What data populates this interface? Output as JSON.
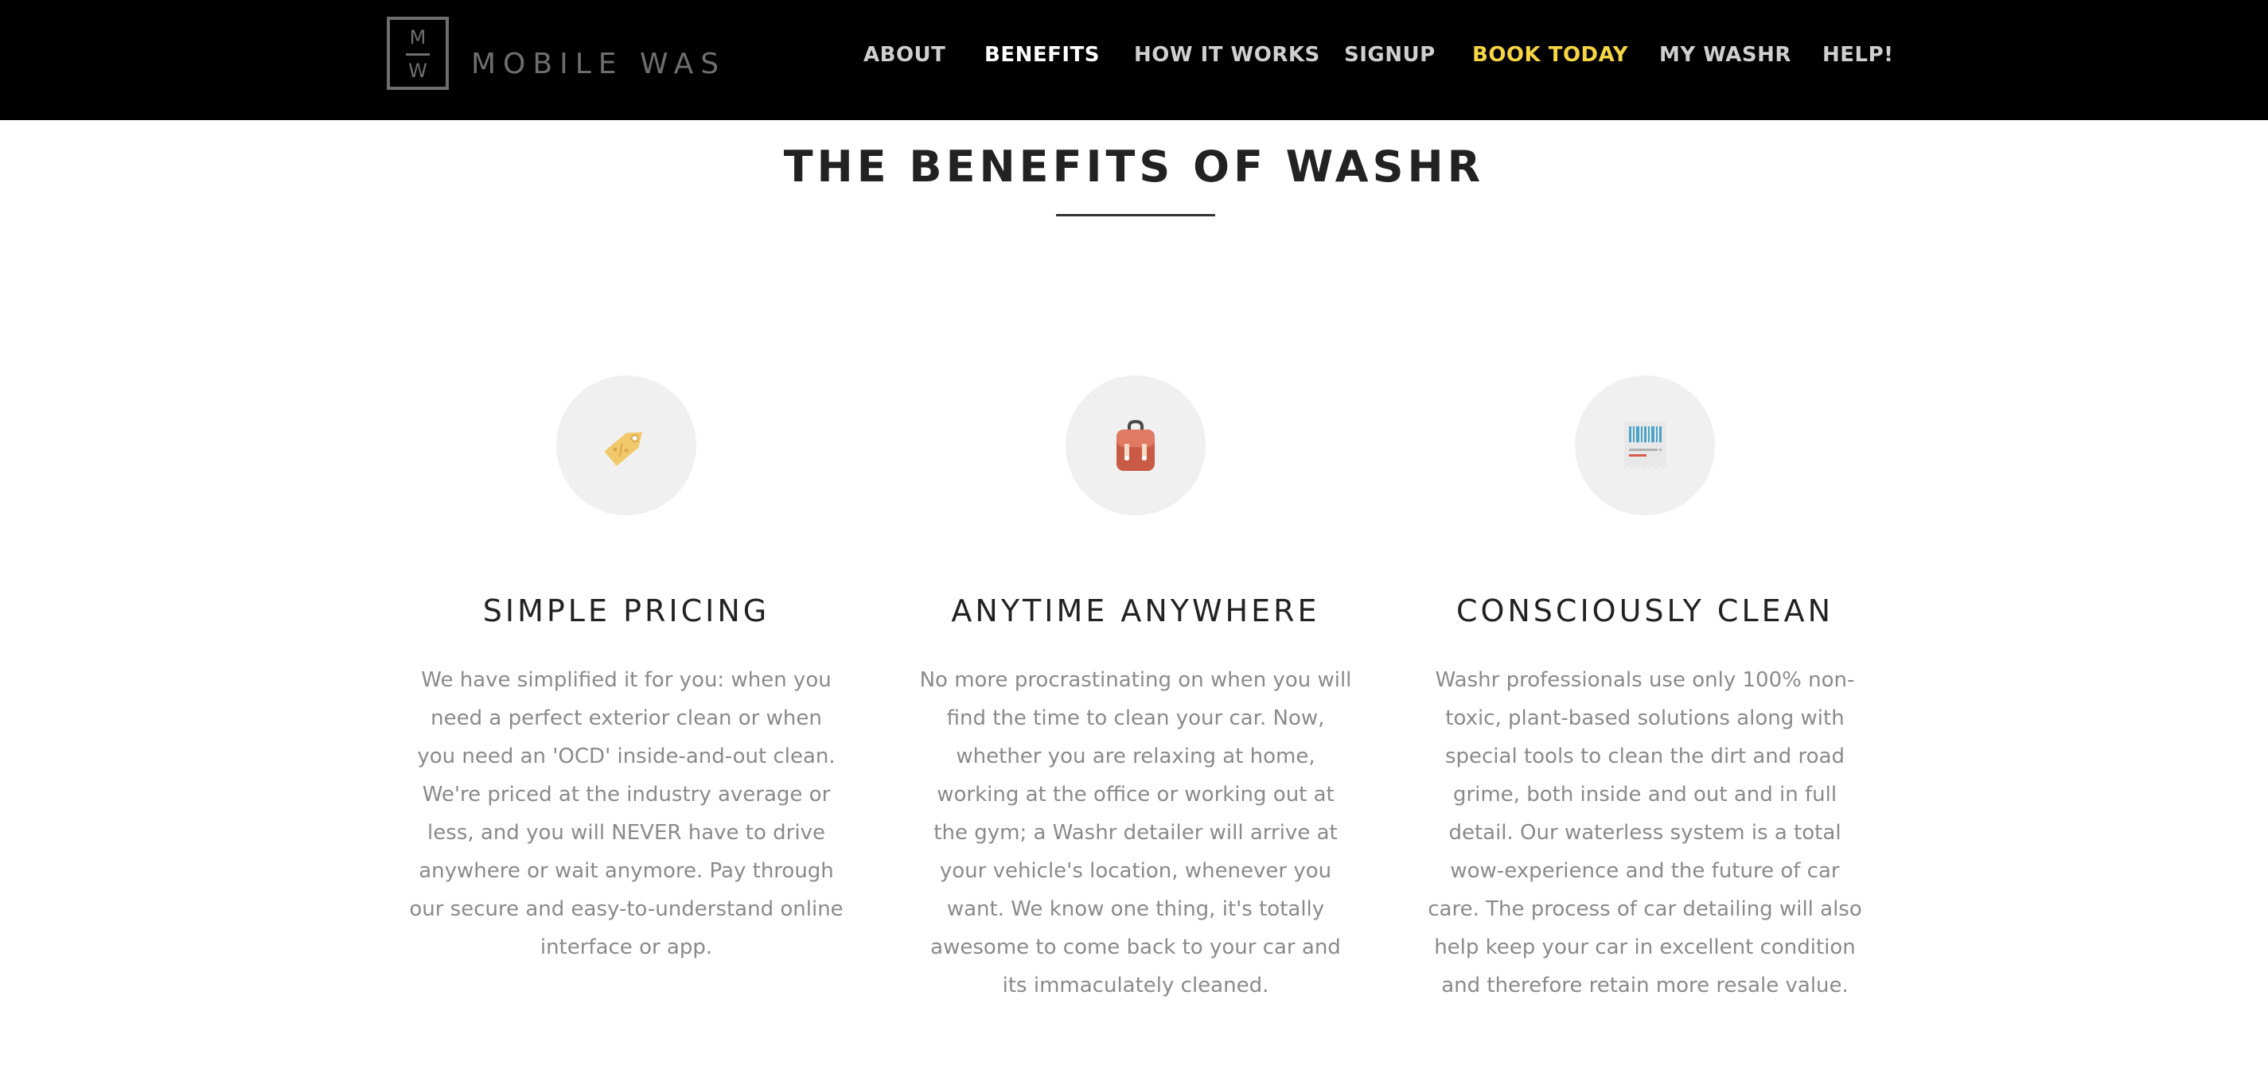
{
  "header": {
    "logo": {
      "letter_top": "M",
      "letter_bottom": "W",
      "text": "MOBILE WAS"
    },
    "nav": {
      "about": "ABOUT",
      "benefits": "BENEFITS",
      "how_it_works": "HOW IT WORKS",
      "signup": "SIGNUP",
      "book_today": "BOOK TODAY",
      "my_washr": "MY WASHR",
      "help": "HELP!"
    },
    "colors": {
      "background": "#000000",
      "nav_text": "#cfcfcf",
      "active": "#ffffff",
      "highlight": "#f5d543"
    }
  },
  "section": {
    "title": "THE BENEFITS OF WASHR"
  },
  "benefits": [
    {
      "icon": "price-tag-icon",
      "title": "SIMPLE PRICING",
      "text": "We have simplified it for you: when you need a perfect exterior clean or when you need an 'OCD' inside-and-out clean. We're priced at the industry average or less, and you will NEVER have to drive anywhere or wait anymore. Pay through our secure and easy-to-understand online interface or app."
    },
    {
      "icon": "backpack-icon",
      "title": "ANYTIME ANYWHERE",
      "text": "No more procrastinating on when you will find the time to clean your car. Now, whether you are relaxing at home, working at the office or working out at the gym; a Washr detailer will arrive at your vehicle's location, whenever you want. We know one thing, it's totally awesome to come back to your car and its immaculately cleaned."
    },
    {
      "icon": "receipt-barcode-icon",
      "title": "CONSCIOUSLY CLEAN",
      "text": "Washr professionals use only 100% non-toxic, plant-based solutions along with special tools to clean the dirt and road grime, both inside and out and in full detail. Our waterless system is a total wow-experience and the future of car care. The process of car detailing will also help keep your car in excellent condition and therefore retain more resale value."
    }
  ]
}
